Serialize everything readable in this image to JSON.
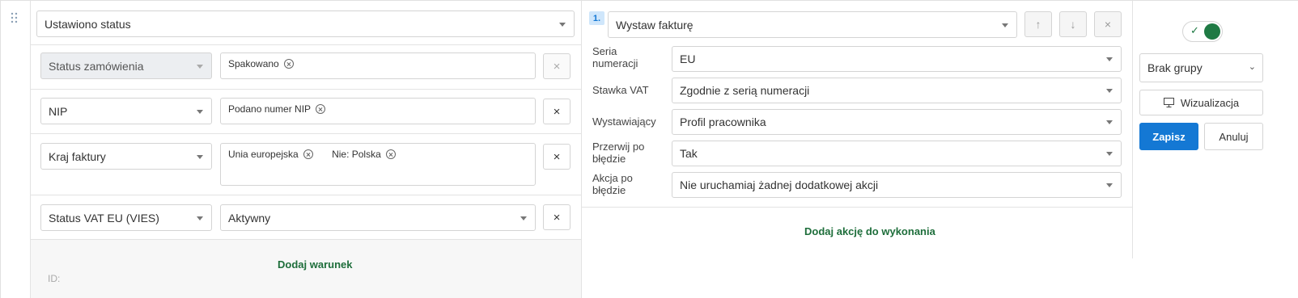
{
  "trigger": {
    "value": "Ustawiono status"
  },
  "conditions": [
    {
      "field": "Status zamówienia",
      "tags": [
        "Spakowano"
      ],
      "remove": "×"
    },
    {
      "field": "NIP",
      "tags": [
        "Podano numer NIP"
      ],
      "remove": "×"
    },
    {
      "field": "Kraj faktury",
      "tags": [
        "Unia europejska",
        "Nie: Polska"
      ],
      "remove": "×"
    },
    {
      "field": "Status VAT EU (VIES)",
      "value": "Aktywny",
      "remove": "×"
    }
  ],
  "add_condition": "Dodaj warunek",
  "id_label": "ID:",
  "action": {
    "number": "1.",
    "value": "Wystaw fakturę",
    "up": "↑",
    "down": "↓",
    "remove": "×",
    "fields": [
      {
        "label": "Seria numeracji",
        "value": "EU"
      },
      {
        "label": "Stawka VAT",
        "value": "Zgodnie z serią numeracji"
      },
      {
        "label": "Wystawiający",
        "value": "Profil pracownika"
      },
      {
        "label": "Przerwij po błędzie",
        "value": "Tak"
      },
      {
        "label": "Akcja po błędzie",
        "value": "Nie uruchamiaj żadnej dodatkowej akcji"
      }
    ]
  },
  "add_action": "Dodaj akcję do wykonania",
  "sidebar": {
    "toggle_on": true,
    "group": "Brak grupy",
    "visualize": "Wizualizacja",
    "save": "Zapisz",
    "cancel": "Anuluj"
  },
  "colors": {
    "accent": "#1478d4",
    "link": "#1e6e3b",
    "toggle": "#1f7a44"
  }
}
